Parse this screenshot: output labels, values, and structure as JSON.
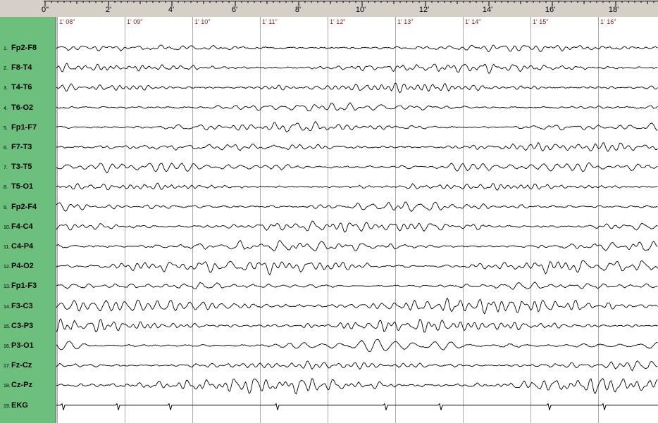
{
  "ruler": {
    "labels": [
      "0\"",
      "2'",
      "4'",
      "6'",
      "8'",
      "10'",
      "12'",
      "14'",
      "16'",
      "18'"
    ]
  },
  "timestamps": [
    "1' 08\"",
    "1' 09\"",
    "1' 10\"",
    "1' 11\"",
    "1' 12\"",
    "1' 13\"",
    "1' 14\"",
    "1' 15\"",
    "1' 16\""
  ],
  "channels": [
    {
      "num": "1.",
      "name": "Fp2-F8"
    },
    {
      "num": "2.",
      "name": "F8-T4"
    },
    {
      "num": "3.",
      "name": "T4-T6"
    },
    {
      "num": "4.",
      "name": "T6-O2"
    },
    {
      "num": "5.",
      "name": "Fp1-F7"
    },
    {
      "num": "6.",
      "name": "F7-T3"
    },
    {
      "num": "7.",
      "name": "T3-T5"
    },
    {
      "num": "8.",
      "name": "T5-O1"
    },
    {
      "num": "9.",
      "name": "Fp2-F4"
    },
    {
      "num": "10.",
      "name": "F4-C4"
    },
    {
      "num": "11.",
      "name": "C4-P4"
    },
    {
      "num": "12.",
      "name": "P4-O2"
    },
    {
      "num": "13.",
      "name": "Fp1-F3"
    },
    {
      "num": "14.",
      "name": "F3-C3"
    },
    {
      "num": "15.",
      "name": "C3-P3"
    },
    {
      "num": "16.",
      "name": "P3-O1"
    },
    {
      "num": "17.",
      "name": "Fz-Cz"
    },
    {
      "num": "18.",
      "name": "Cz-Pz"
    },
    {
      "num": "19.",
      "name": "EKG"
    }
  ],
  "colors": {
    "sidebar": "#6dbf7d",
    "trace": "#000000",
    "gridline": "#a8a8a8",
    "timestamp": "#8b1a1a"
  }
}
